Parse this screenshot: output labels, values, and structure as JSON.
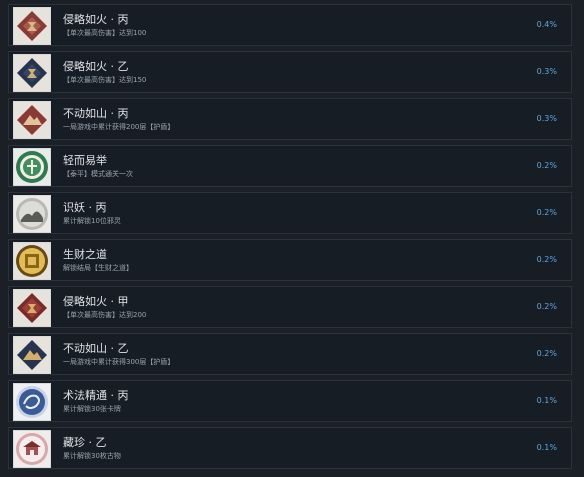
{
  "achievements": [
    {
      "title": "侵略如火 · 丙",
      "desc": "【单次最高伤害】达到100",
      "percent": "0.4%",
      "icon": "red-diamond-gold-mark-icon",
      "colors": {
        "bg": "#e6e3dc",
        "shape": "#8a3a34",
        "inner": "#d9b98a"
      }
    },
    {
      "title": "侵略如火 · 乙",
      "desc": "【单次最高伤害】达到150",
      "percent": "0.3%",
      "icon": "navy-diamond-gold-mark-icon",
      "colors": {
        "bg": "#e6e3dc",
        "shape": "#26344f",
        "inner": "#d6b06a"
      }
    },
    {
      "title": "不动如山 · 丙",
      "desc": "一局游戏中累计获得200层【护盾】",
      "percent": "0.3%",
      "icon": "red-diamond-mountain-icon",
      "colors": {
        "bg": "#e6e3dc",
        "shape": "#8a3a34",
        "inner": "#e0c49a"
      }
    },
    {
      "title": "轻而易举",
      "desc": "【泰平】模式通关一次",
      "percent": "0.2%",
      "icon": "green-jade-seal-icon",
      "colors": {
        "bg": "#e8ece8",
        "shape": "#2f7a52",
        "inner": "#f3efe3"
      }
    },
    {
      "title": "识妖 · 丙",
      "desc": "累计解锁10位邪灵",
      "percent": "0.2%",
      "icon": "ink-painting-medallion-icon",
      "colors": {
        "bg": "#eceae6",
        "shape": "#b8b8b4",
        "inner": "#5a5a58"
      }
    },
    {
      "title": "生财之道",
      "desc": "解锁结局【生财之道】",
      "percent": "0.2%",
      "icon": "gold-coin-icon",
      "colors": {
        "bg": "#e6e3dc",
        "shape": "#6a4a12",
        "inner": "#e2bd57"
      }
    },
    {
      "title": "侵略如火 · 甲",
      "desc": "【单次最高伤害】达到200",
      "percent": "0.2%",
      "icon": "crimson-diamond-gold-mark-icon",
      "colors": {
        "bg": "#e6e3dc",
        "shape": "#7a2a2a",
        "inner": "#d9b06a"
      }
    },
    {
      "title": "不动如山 · 乙",
      "desc": "一局游戏中累计获得300层【护盾】",
      "percent": "0.2%",
      "icon": "navy-diamond-mountain-icon",
      "colors": {
        "bg": "#e6e3dc",
        "shape": "#26344f",
        "inner": "#d6b06a"
      }
    },
    {
      "title": "术法精通 · 丙",
      "desc": "累计解锁30张卡牌",
      "percent": "0.1%",
      "icon": "blue-swirl-medallion-icon",
      "colors": {
        "bg": "#eef0f4",
        "shape": "#3a5a9a",
        "inner": "#c9d3e6"
      }
    },
    {
      "title": "藏珍 · 乙",
      "desc": "累计解锁30枚古物",
      "percent": "0.1%",
      "icon": "pink-pavilion-medallion-icon",
      "colors": {
        "bg": "#f1eceb",
        "shape": "#d8a7a7",
        "inner": "#7a2f2f"
      }
    }
  ]
}
